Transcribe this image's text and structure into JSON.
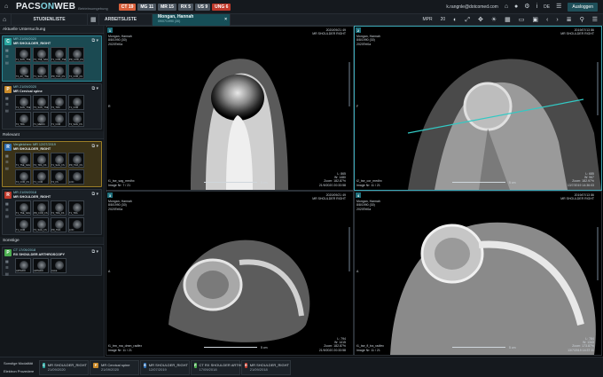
{
  "app": {
    "logo_a": "PACS",
    "logo_b": "ON",
    "logo_c": "WEB",
    "subtitle": "Betriebsumgebung"
  },
  "badges": [
    {
      "label": "CT 19",
      "color": "#d9603b"
    },
    {
      "label": "MG 11",
      "color": "#4b5560"
    },
    {
      "label": "MR 15",
      "color": "#4b5560"
    },
    {
      "label": "RX 5",
      "color": "#4b5560"
    },
    {
      "label": "US 9",
      "color": "#4b5560"
    },
    {
      "label": "UNG 6",
      "color": "#c0392b"
    }
  ],
  "user": {
    "email": "k.rangnle@dotcomed.com",
    "logout": "Ausloggen",
    "lang": "DE"
  },
  "tabs": {
    "studienliste": "STUDIENLISTE",
    "arbeitsliste": "ARBEITSLISTE",
    "patient_name": "Mongan, Hannah",
    "patient_sub": "09/07/1990 (30)"
  },
  "toolbar": {
    "mpr": "MPR",
    "mpr_val": "20"
  },
  "sidebar": {
    "current_header": "Aktuelle Untersuchung",
    "relevant_header": "Relevant",
    "other_header": "Sonstige",
    "studies": [
      {
        "letter": "C",
        "color": "#2aa7a0",
        "mod": "MR 21/09/2020",
        "title": "MR SHOULDER_RIGHT",
        "style": "active",
        "thumbs": [
          "T1_SAG_TSE",
          "T2_TSE_SAG",
          "T1_COR_TSE",
          "PD_COR_FS",
          "T2_AX_TSE",
          "T1_SAG_FS",
          "PD_TRA_FS",
          "T2_COR_FS"
        ]
      },
      {
        "letter": "P",
        "color": "#c98a2a",
        "mod": "MR 21/09/2020",
        "title": "MR Cervical spine",
        "style": "plain",
        "thumbs": [
          "T1_SAG_TSE",
          "T2_SAG_TSE",
          "T2_TRA",
          "T1_COR",
          "T2_TRA",
          "T1_MEDIC",
          "T1_COR",
          "T2_SAG_FS"
        ]
      },
      {
        "letter": "R",
        "color": "#2d6fb5",
        "mod": "Vergleichen: MR 12/07/2019",
        "title": "MR SHOULDER_RIGHT",
        "style": "warn",
        "thumbs": [
          "T1_TSE_SAG",
          "T2_TRA_FS",
          "T1_SAG_FS",
          "PD_TRA_FS",
          "T2_COR_FS",
          "T1_COR",
          "T2_FS",
          "LOC"
        ]
      },
      {
        "letter": "R",
        "color": "#c0392b",
        "mod": "MR 21/09/2018",
        "title": "MR SHOULDER_RIGHT",
        "style": "plain",
        "thumbs": [
          "T1_TSE_SAG",
          "PD_COR_FS",
          "T2_TRA_FS",
          "T1_TRA",
          "T1_COR",
          "T2_SAG_FS",
          "PD_TRA",
          "LOC"
        ]
      },
      {
        "letter": "P",
        "color": "#4caf50",
        "mod": "CT 17/09/2018",
        "title": "RX SHOULDER ARTHROSCOPY",
        "style": "plain",
        "thumbs": [
          "ARTHRO",
          "ARTHRO",
          "ALLE"
        ]
      }
    ]
  },
  "viewports": [
    {
      "num": "1",
      "patient": "Mongan, Hannah",
      "dob": "8/8/1990 (30)",
      "id": "2020Tel0a",
      "date": "2020/09/21 49",
      "study": "MR SHOULDER RIGHT",
      "series": "t1_tse_sag_medhx",
      "img": "Image Nr: 7 / 21",
      "zoom": "Zoom: 182.87%",
      "wl": "L: 865",
      "ww": "W: 1480",
      "dt": "21/9/2020 20:33:58",
      "scale": "5 cm",
      "orient_l": "R"
    },
    {
      "num": "2",
      "patient": "Mongan, Hannah",
      "dob": "8/8/1990 (30)",
      "id": "2020Tel0a",
      "date": "2019/07/13 86",
      "study": "MR SHOULDER RIGHT",
      "series": "t2_tse_cor_medhx",
      "img": "Image Nr: 11 / 21",
      "zoom": "Zoom: 182.97%",
      "wl": "L: 685",
      "ww": "W: 967",
      "dt": "13/7/2019 14:36:03",
      "scale": "5 cm",
      "orient_l": "F"
    },
    {
      "num": "3",
      "patient": "Mongan, Hannah",
      "dob": "8/8/1990 (30)",
      "id": "2020Tel0a",
      "date": "2020/09/21 49",
      "study": "MR SHOULDER RIGHT",
      "series": "t1_trm_ma_dmm_radfex",
      "img": "Image Nr: 11 / 21",
      "zoom": "Zoom: 182.87%",
      "wl": "L: 794",
      "ww": "W: 1415",
      "dt": "21/9/2020 20:33:58",
      "scale": "5 cm",
      "orient_l": "A"
    },
    {
      "num": "4",
      "patient": "Mongan, Hannah",
      "dob": "8/8/1990 (30)",
      "id": "2020Tel0a",
      "date": "2019/07/13 86",
      "study": "MR SHOULDER RIGHT",
      "series": "t1_tse_fl_tra_radfex",
      "img": "Image Nr: 11 / 21",
      "zoom": "Zoom: 173.87%",
      "wl": "L: 784",
      "ww": "W: 1343",
      "dt": "13/7/2019 14:37:11",
      "scale": "5 cm",
      "orient_l": "A"
    }
  ],
  "bottom": {
    "left1": "Sonstige Modalität",
    "left2": "Elektron Prozedere",
    "cards": [
      {
        "letter": "C",
        "color": "#2aa7a0",
        "label": "MR SHOULDER_RIGHT",
        "date": "21/09/2020"
      },
      {
        "letter": "P",
        "color": "#c98a2a",
        "label": "MR Cervical spine",
        "date": "21/09/2020"
      },
      {
        "letter": "R",
        "color": "#2d6fb5",
        "label": "MR SHOULDER_RIGHT",
        "date": "12/07/2019"
      },
      {
        "letter": "P",
        "color": "#4caf50",
        "label": "CT RX SHOULDER ARTHROSCOPY",
        "date": "17/09/2018"
      },
      {
        "letter": "R",
        "color": "#c0392b",
        "label": "MR SHOULDER_RIGHT",
        "date": "21/09/2018"
      }
    ]
  }
}
